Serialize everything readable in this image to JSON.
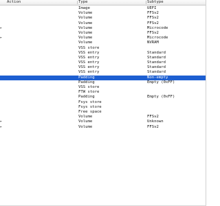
{
  "columns": {
    "action": "Action",
    "type": "Type",
    "subtype": "Subtype"
  },
  "rows": [
    {
      "tree": "",
      "type": "Image",
      "subtype": "UEFI"
    },
    {
      "tree": "",
      "type": "Volume",
      "subtype": "FFSv2"
    },
    {
      "tree": "",
      "type": "Volume",
      "subtype": "FFSv2"
    },
    {
      "tree": "",
      "type": "Volume",
      "subtype": "FFSv2"
    },
    {
      "tree": "▸",
      "type": "Volume",
      "subtype": "Microcode"
    },
    {
      "tree": "",
      "type": "Volume",
      "subtype": "FFSv2"
    },
    {
      "tree": "▸",
      "type": "Volume",
      "subtype": "Microcode"
    },
    {
      "tree": "",
      "type": "Volume",
      "subtype": "NVRAM"
    },
    {
      "tree": "",
      "type": "VSS store",
      "subtype": ""
    },
    {
      "tree": "",
      "type": "VSS entry",
      "subtype": "Standard"
    },
    {
      "tree": "",
      "type": "VSS entry",
      "subtype": "Standard"
    },
    {
      "tree": "",
      "type": "VSS entry",
      "subtype": "Standard"
    },
    {
      "tree": "",
      "type": "VSS entry",
      "subtype": "Standard"
    },
    {
      "tree": "",
      "type": "VSS entry",
      "subtype": "Standard"
    },
    {
      "tree": "",
      "type": "Padding",
      "subtype": "Non-empty",
      "selected": true
    },
    {
      "tree": "",
      "type": "Padding",
      "subtype": "Empty (0xFF)"
    },
    {
      "tree": "",
      "type": "VSS store",
      "subtype": ""
    },
    {
      "tree": "",
      "type": "FTW store",
      "subtype": ""
    },
    {
      "tree": "",
      "type": "Padding",
      "subtype": "Empty (0xFF)"
    },
    {
      "tree": "",
      "type": "Fsys store",
      "subtype": ""
    },
    {
      "tree": "",
      "type": "Fsys store",
      "subtype": ""
    },
    {
      "tree": "",
      "type": "Free space",
      "subtype": ""
    },
    {
      "tree": "",
      "type": "Volume",
      "subtype": "FFSv2"
    },
    {
      "tree": "▸",
      "type": "Volume",
      "subtype": "Unknown"
    },
    {
      "tree": "▸",
      "type": "Volume",
      "subtype": "FFSv2"
    }
  ],
  "colors": {
    "selection": "#1d5fd1",
    "selection_text": "#ffffff",
    "background": "#ffffff"
  }
}
